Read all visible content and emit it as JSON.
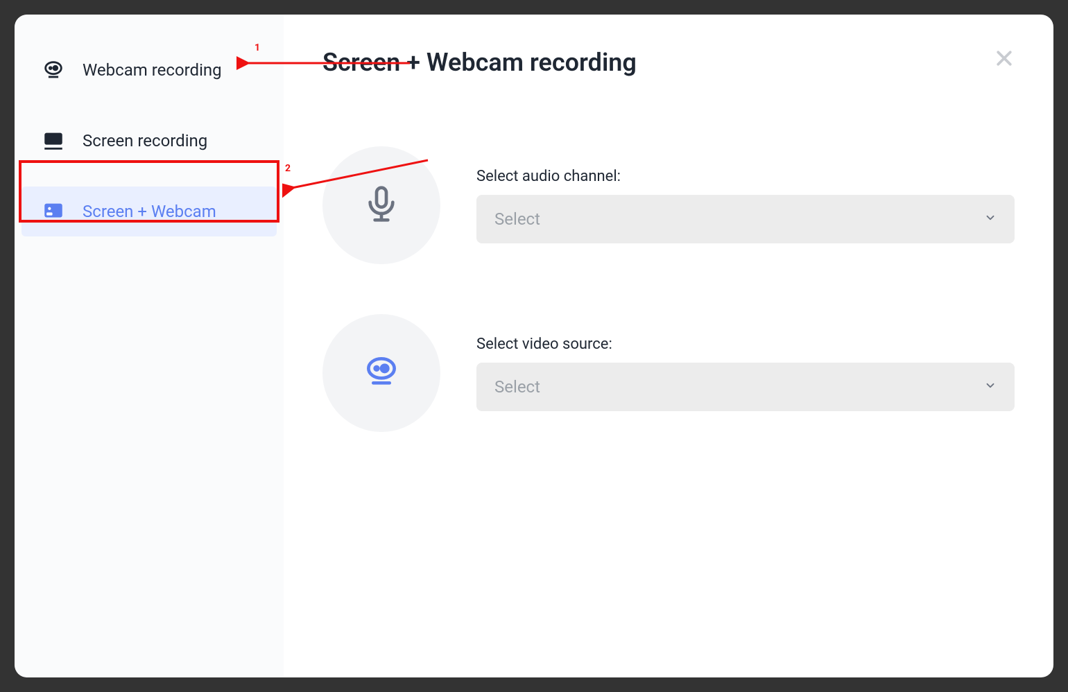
{
  "sidebar": {
    "items": [
      {
        "label": "Webcam recording"
      },
      {
        "label": "Screen recording"
      },
      {
        "label": "Screen + Webcam"
      }
    ]
  },
  "main": {
    "title": "Screen + Webcam recording",
    "audio": {
      "label": "Select audio channel:",
      "placeholder": "Select"
    },
    "video": {
      "label": "Select video source:",
      "placeholder": "Select"
    }
  },
  "annotations": {
    "num1": "1",
    "num2": "2"
  }
}
